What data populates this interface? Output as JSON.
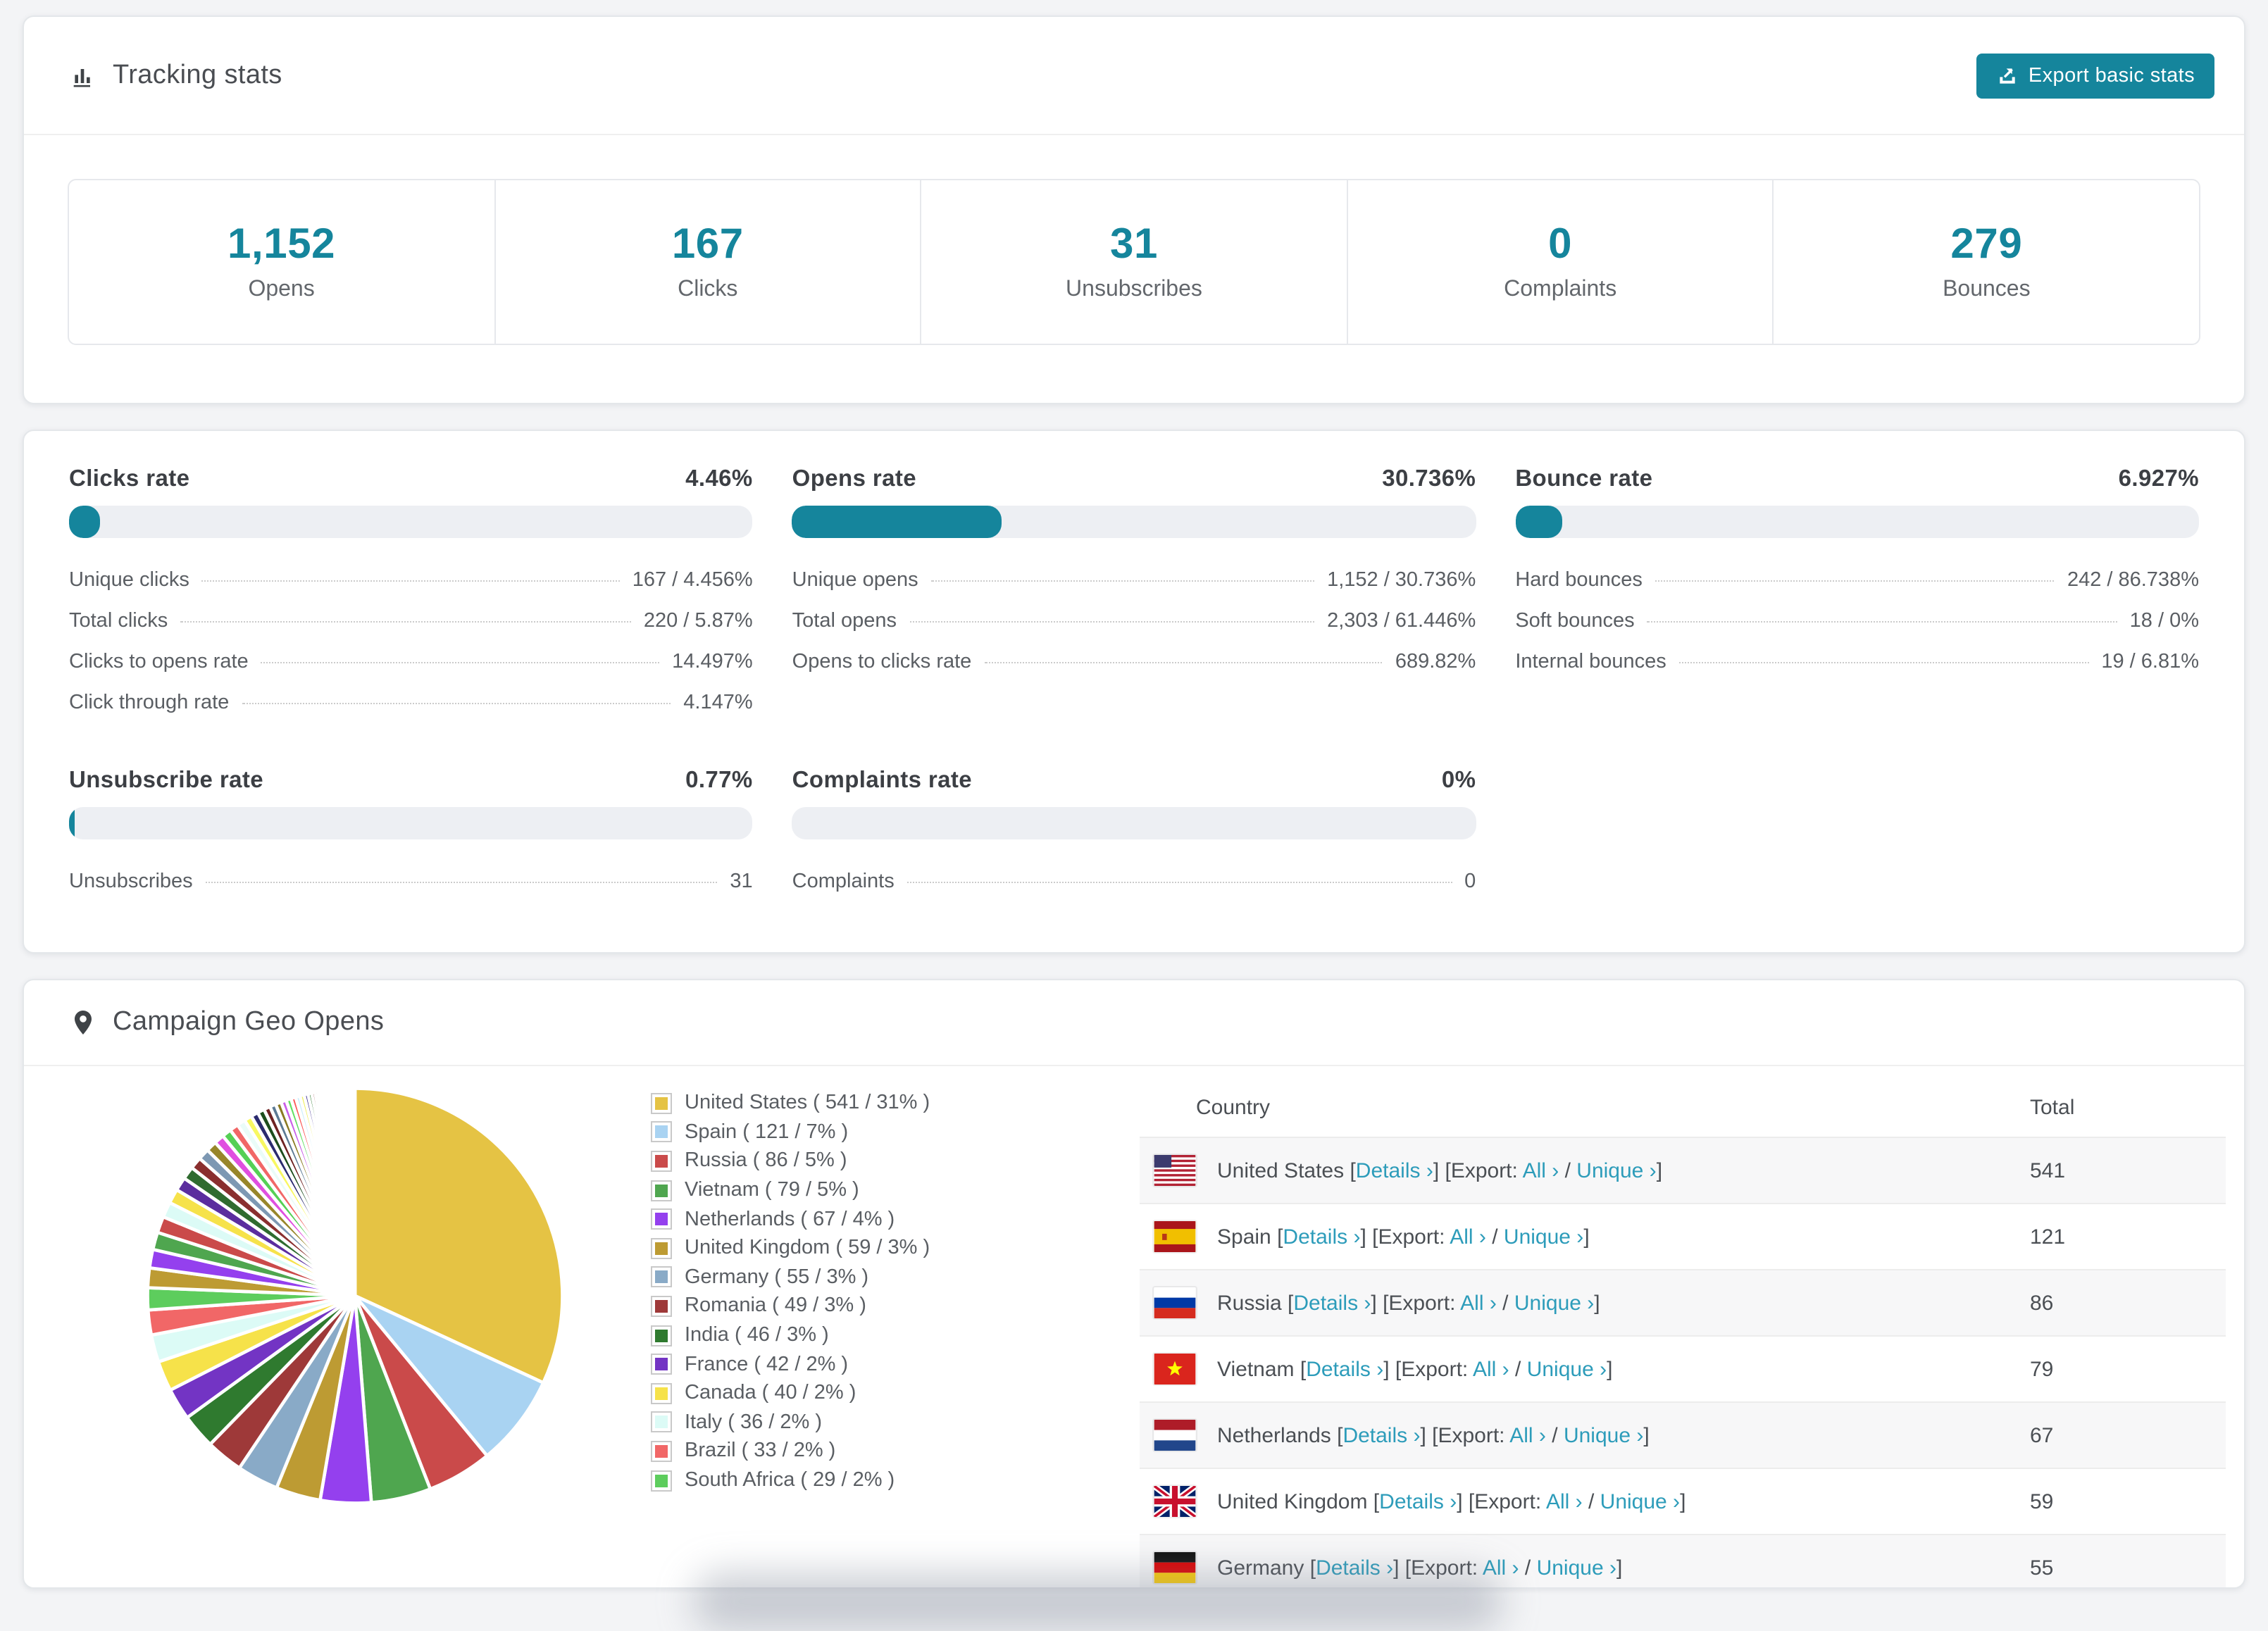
{
  "page": {
    "bg": "#f3f4f6",
    "accent": "#15859c",
    "link_color": "#2d9cba"
  },
  "tracking": {
    "title": "Tracking stats",
    "export_label": "Export basic stats",
    "summary": [
      {
        "value": "1,152",
        "label": "Opens"
      },
      {
        "value": "167",
        "label": "Clicks"
      },
      {
        "value": "31",
        "label": "Unsubscribes"
      },
      {
        "value": "0",
        "label": "Complaints"
      },
      {
        "value": "279",
        "label": "Bounces"
      }
    ]
  },
  "rates": [
    {
      "title": "Clicks rate",
      "value": "4.46%",
      "percent": 4.46,
      "rows": [
        [
          "Unique clicks",
          "167 / 4.456%"
        ],
        [
          "Total clicks",
          "220 / 5.87%"
        ],
        [
          "Clicks to opens rate",
          "14.497%"
        ],
        [
          "Click through rate",
          "4.147%"
        ]
      ]
    },
    {
      "title": "Opens rate",
      "value": "30.736%",
      "percent": 30.736,
      "rows": [
        [
          "Unique opens",
          "1,152 / 30.736%"
        ],
        [
          "Total opens",
          "2,303 / 61.446%"
        ],
        [
          "Opens to clicks rate",
          "689.82%"
        ]
      ]
    },
    {
      "title": "Bounce rate",
      "value": "6.927%",
      "percent": 6.927,
      "rows": [
        [
          "Hard bounces",
          "242 / 86.738%"
        ],
        [
          "Soft bounces",
          "18 / 0%"
        ],
        [
          "Internal bounces",
          "19 / 6.81%"
        ]
      ]
    },
    {
      "title": "Unsubscribe rate",
      "value": "0.77%",
      "percent": 0.77,
      "rows": [
        [
          "Unsubscribes",
          "31"
        ]
      ]
    },
    {
      "title": "Complaints rate",
      "value": "0%",
      "percent": 0,
      "rows": [
        [
          "Complaints",
          "0"
        ]
      ]
    }
  ],
  "geo": {
    "title": "Campaign Geo Opens",
    "table_headers": {
      "country": "Country",
      "total": "Total"
    },
    "links": {
      "details": "Details",
      "export_prefix": "Export:",
      "all": "All",
      "unique": "Unique",
      "chevron": "›"
    },
    "rows": [
      {
        "country": "United States",
        "flag": "us",
        "total": "541"
      },
      {
        "country": "Spain",
        "flag": "es",
        "total": "121"
      },
      {
        "country": "Russia",
        "flag": "ru",
        "total": "86"
      },
      {
        "country": "Vietnam",
        "flag": "vn",
        "total": "79"
      },
      {
        "country": "Netherlands",
        "flag": "nl",
        "total": "67"
      },
      {
        "country": "United Kingdom",
        "flag": "gb",
        "total": "59"
      },
      {
        "country": "Germany",
        "flag": "de",
        "total": "55"
      }
    ]
  },
  "chart_data": {
    "type": "pie",
    "title": "Campaign Geo Opens",
    "unit": "opens",
    "legend_position": "right",
    "start_angle_deg": -90,
    "direction": "clockwise",
    "slices": [
      {
        "label": "United States",
        "value": 541,
        "pct": "31%",
        "color": "#e5c344"
      },
      {
        "label": "Spain",
        "value": 121,
        "pct": "7%",
        "color": "#a9d3f2"
      },
      {
        "label": "Russia",
        "value": 86,
        "pct": "5%",
        "color": "#ca4a4a"
      },
      {
        "label": "Vietnam",
        "value": 79,
        "pct": "5%",
        "color": "#4fa64f"
      },
      {
        "label": "Netherlands",
        "value": 67,
        "pct": "4%",
        "color": "#9440ee"
      },
      {
        "label": "United Kingdom",
        "value": 59,
        "pct": "3%",
        "color": "#bd9b33"
      },
      {
        "label": "Germany",
        "value": 55,
        "pct": "3%",
        "color": "#89aac7"
      },
      {
        "label": "Romania",
        "value": 49,
        "pct": "3%",
        "color": "#9e3939"
      },
      {
        "label": "India",
        "value": 46,
        "pct": "3%",
        "color": "#2f7a2f"
      },
      {
        "label": "France",
        "value": 42,
        "pct": "2%",
        "color": "#7334c4"
      },
      {
        "label": "Canada",
        "value": 40,
        "pct": "2%",
        "color": "#f6e24a"
      },
      {
        "label": "Italy",
        "value": 36,
        "pct": "2%",
        "color": "#dcfbf6"
      },
      {
        "label": "Brazil",
        "value": 33,
        "pct": "2%",
        "color": "#f16767"
      },
      {
        "label": "South Africa",
        "value": 29,
        "pct": "2%",
        "color": "#5dcd5d"
      }
    ],
    "other_slices": {
      "note": "long tail of smaller countries rendered as shrinking slivers",
      "start_value": 26,
      "decay": 0.94,
      "count": 50,
      "palette": [
        "#bd9b33",
        "#9440ee",
        "#4fa64f",
        "#ca4a4a",
        "#dcfbf6",
        "#f6e24a",
        "#5b2d9e",
        "#2f6b2f",
        "#8a2f2f",
        "#7d98b3",
        "#98862a",
        "#e04fe0",
        "#55d055",
        "#f16767",
        "#eafcf8",
        "#f8f861",
        "#2b2b6e",
        "#1d4d1d",
        "#6e2222",
        "#5c7a94",
        "#8a7a22",
        "#c95fe8",
        "#63de63",
        "#fb5b5b",
        "#cdeefc",
        "#efef5a",
        "#3b2b8e",
        "#166b16",
        "#7a1f1f",
        "#44607a"
      ]
    }
  }
}
